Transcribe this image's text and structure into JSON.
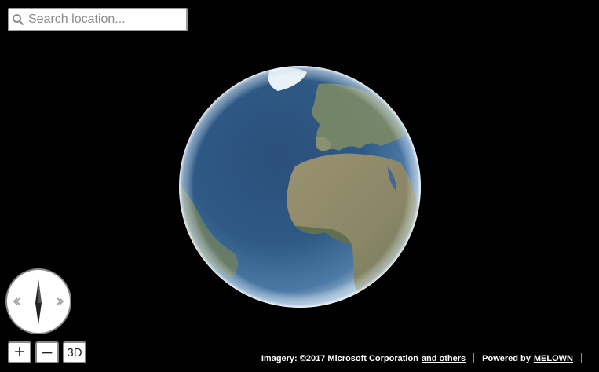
{
  "search": {
    "placeholder": "Search location..."
  },
  "icons": {
    "search": "search-icon",
    "compass": "compass-icon"
  },
  "controls": {
    "zoom_in": "+",
    "zoom_out": "−",
    "mode_3d": "3D"
  },
  "attribution": {
    "imagery": "Imagery: ©2017 Microsoft Corporation",
    "others_link": "and others",
    "powered_by": "Powered by",
    "brand": "MELOWN"
  },
  "colors": {
    "background": "#000000",
    "ocean": "#2f5a86",
    "land": "#8c8a6a",
    "ice": "#e8f1f6"
  }
}
